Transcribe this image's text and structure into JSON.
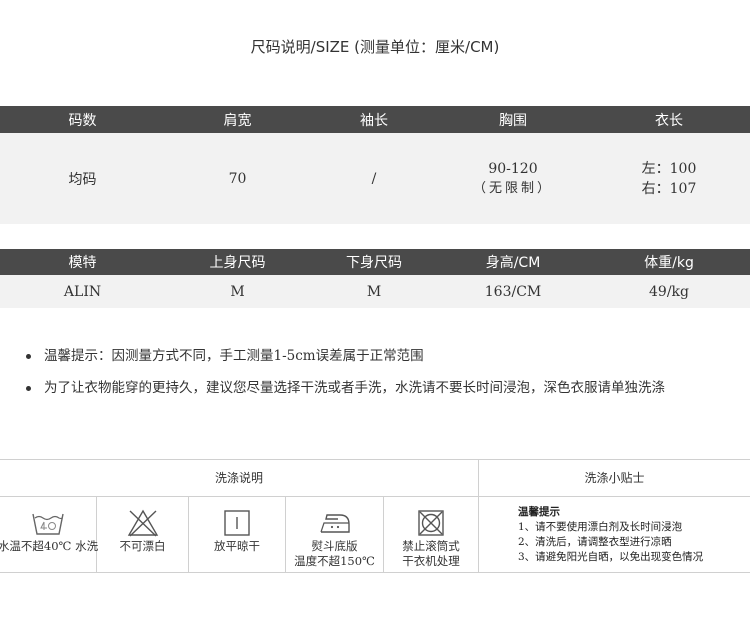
{
  "title": "尺码说明/SIZE (测量单位：厘米/CM)",
  "size_table": {
    "headers": [
      "码数",
      "肩宽",
      "袖长",
      "胸围",
      "衣长"
    ],
    "row": {
      "size": "均码",
      "shoulder": "70",
      "sleeve": "/",
      "chest_line1": "90-120",
      "chest_line2": "（无限制）",
      "length_line1": "左：100",
      "length_line2": "右：107"
    }
  },
  "model_table": {
    "headers": [
      "模特",
      "上身尺码",
      "下身尺码",
      "身高/CM",
      "体重/kg"
    ],
    "row": [
      "ALIN",
      "M",
      "M",
      "163/CM",
      "49/kg"
    ]
  },
  "notes": [
    "温馨提示：因测量方式不同，手工测量1-5cm误差属于正常范围",
    "为了让衣物能穿的更持久，建议您尽量选择干洗或者手洗，水洗请不要长时间浸泡，深色衣服请单独洗涤"
  ],
  "wash": {
    "header_left": "洗涤说明",
    "header_right": "洗涤小贴士",
    "symbols": [
      {
        "icon": "wash-40-icon",
        "label1": "水温不超40℃ 水洗",
        "label2": ""
      },
      {
        "icon": "no-bleach-icon",
        "label1": "不可漂白",
        "label2": ""
      },
      {
        "icon": "dry-flat-icon",
        "label1": "放平晾干",
        "label2": ""
      },
      {
        "icon": "iron-icon",
        "label1": "熨斗底版",
        "label2": "温度不超150℃"
      },
      {
        "icon": "no-tumble-dry-icon",
        "label1": "禁止滚筒式",
        "label2": "干衣机处理"
      }
    ],
    "tips_title": "温馨提示",
    "tips": [
      "1、请不要使用漂白剂及长时间浸泡",
      "2、清洗后，请调整衣型进行凉晒",
      "3、请避免阳光自晒，以免出现变色情况"
    ]
  }
}
